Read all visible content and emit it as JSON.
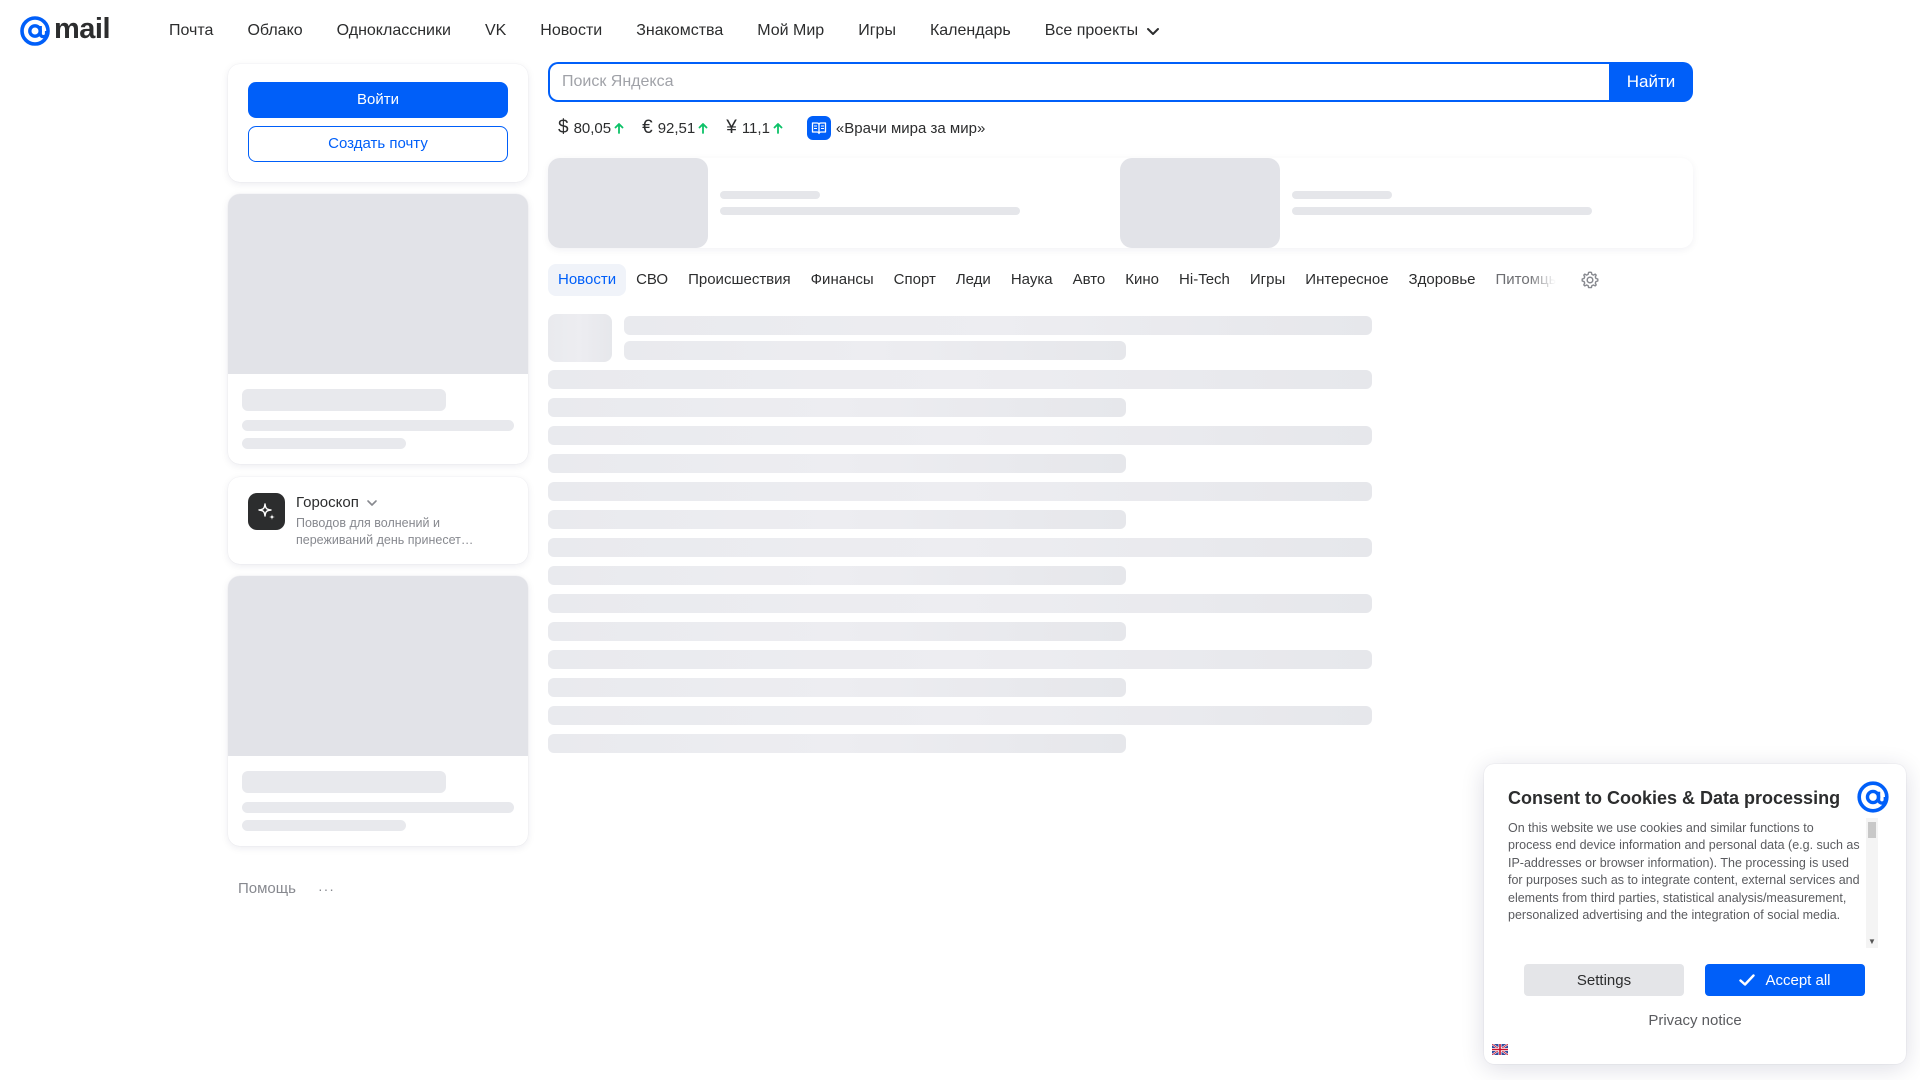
{
  "brand": {
    "logo_text": "mail",
    "accent": "#005ff9"
  },
  "nav": {
    "items": [
      "Почта",
      "Облако",
      "Одноклассники",
      "VK",
      "Новости",
      "Знакомства",
      "Мой Мир",
      "Игры",
      "Календарь"
    ],
    "all_projects": "Все проекты"
  },
  "login": {
    "login_button": "Войти",
    "create_button": "Создать почту"
  },
  "horoscope": {
    "title": "Гороскоп",
    "text": "Поводов для волнений и переживаний день принесет…"
  },
  "footer": {
    "help": "Помощь",
    "more": "···"
  },
  "search": {
    "placeholder": "Поиск Яндекса",
    "button": "Найти"
  },
  "rates": [
    {
      "symbol": "$",
      "value": "80,05"
    },
    {
      "symbol": "€",
      "value": "92,51"
    },
    {
      "symbol": "¥",
      "value": "11,1"
    }
  ],
  "promo": {
    "text": "«Врачи мира за мир»"
  },
  "tabs": {
    "items": [
      "Новости",
      "СВО",
      "Происшествия",
      "Финансы",
      "Спорт",
      "Леди",
      "Наука",
      "Авто",
      "Кино",
      "Hi-Tech",
      "Игры",
      "Интересное",
      "Здоровье",
      "Питомцы"
    ],
    "active_index": 0
  },
  "consent": {
    "title": "Consent to Cookies & Data processing",
    "text": "On this website we use cookies and similar functions to process end device information and personal data (e.g. such as IP-addresses or browser information). The processing is used for purposes such as to integrate content, external services and elements from third parties, statistical analysis/measurement, personalized advertising and the integration of social media.",
    "settings_button": "Settings",
    "accept_button": "Accept all",
    "privacy_link": "Privacy notice"
  },
  "icons": {
    "logo": "at-sign-icon",
    "nav_chevron": "chevron-down-icon",
    "rate_up": "arrow-up-icon",
    "promo": "book-icon",
    "horoscope": "sparkles-icon",
    "tabs_settings": "gear-icon",
    "accept": "check-icon",
    "language": "flag-icon"
  }
}
